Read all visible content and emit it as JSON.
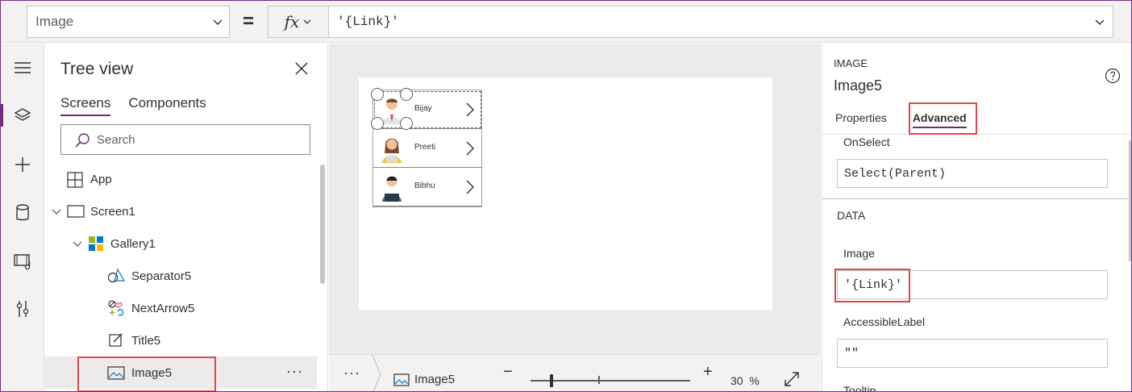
{
  "formula_bar": {
    "property": "Image",
    "equals": "=",
    "fx_label": "fx",
    "formula": "'{Link}'"
  },
  "rail": {
    "items": [
      "hamburger-icon",
      "layers-icon",
      "plus-icon",
      "database-icon",
      "media-icon",
      "tools-icon"
    ]
  },
  "tree": {
    "title": "Tree view",
    "tabs": [
      "Screens",
      "Components"
    ],
    "search_placeholder": "Search",
    "nodes": {
      "app": "App",
      "screen": "Screen1",
      "gallery": "Gallery1",
      "separator": "Separator5",
      "nextarrow": "NextArrow5",
      "title": "Title5",
      "image": "Image5"
    },
    "more": "···"
  },
  "canvas": {
    "rows": [
      "Bijay",
      "Preeti",
      "Bibhu"
    ]
  },
  "bottom_bar": {
    "more": "···",
    "breadcrumb": "Image5",
    "zoom_minus": "−",
    "zoom_plus": "+",
    "zoom": "30",
    "zoom_unit": "%"
  },
  "properties": {
    "type": "IMAGE",
    "name": "Image5",
    "tabs": [
      "Properties",
      "Advanced"
    ],
    "onselect_label": "OnSelect",
    "onselect_value": "Select(Parent)",
    "section_data": "DATA",
    "image_label": "Image",
    "image_value": "'{Link}'",
    "accessible_label": "AccessibleLabel",
    "accessible_value": "\"\"",
    "tooltip_label": "Tooltip"
  },
  "colors": {
    "accent": "#742774",
    "highlight": "#e0474c"
  }
}
